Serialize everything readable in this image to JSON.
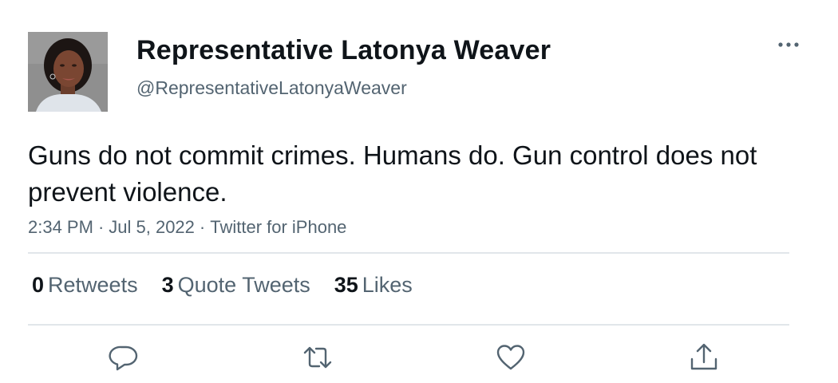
{
  "author": {
    "display_name": "Representative Latonya Weaver",
    "handle": "@RepresentativeLatonyaWeaver",
    "avatar_icon": "profile-photo"
  },
  "tweet": {
    "text": "Guns do not commit crimes. Humans do. Gun control does not prevent violence.",
    "time": "2:34 PM",
    "date": "Jul 5, 2022",
    "source": "Twitter for iPhone",
    "separator": "·"
  },
  "stats": {
    "retweets_count": "0",
    "retweets_label": "Retweets",
    "quote_tweets_count": "3",
    "quote_tweets_label": "Quote Tweets",
    "likes_count": "35",
    "likes_label": "Likes"
  },
  "actions": {
    "reply_icon": "reply-icon",
    "retweet_icon": "retweet-icon",
    "like_icon": "like-icon",
    "share_icon": "share-icon",
    "more_icon": "more-icon"
  },
  "colors": {
    "text_primary": "#0f1419",
    "text_secondary": "#536471",
    "divider": "#e1e6ea",
    "icon": "#536471"
  }
}
